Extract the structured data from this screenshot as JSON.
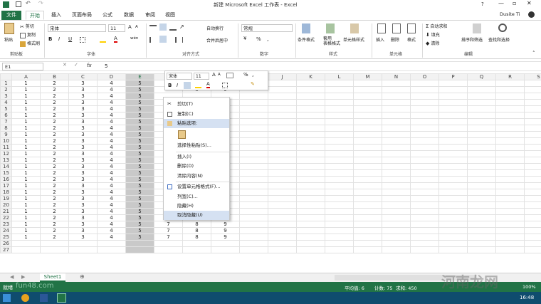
{
  "window": {
    "title": "新建 Microsoft Excel 工作表 - Excel",
    "user": "Dusite Ti",
    "help": "?"
  },
  "tabs": [
    "文件",
    "开始",
    "插入",
    "页面布局",
    "公式",
    "数据",
    "审阅",
    "视图"
  ],
  "ribbon": {
    "clipboard": {
      "paste": "粘贴",
      "cut": "剪切",
      "copy": "复制",
      "format_painter": "格式刷",
      "group": "剪贴板"
    },
    "font": {
      "name": "宋体",
      "size": "11",
      "bold": "B",
      "italic": "I",
      "underline": "U",
      "grow": "A",
      "shrink": "A",
      "wen": "wén",
      "group": "字体"
    },
    "alignment": {
      "wrap": "自动换行",
      "merge": "合并后居中",
      "group": "对齐方式"
    },
    "number": {
      "format": "常规",
      "percent": "%",
      "comma": ",",
      "group": "数字"
    },
    "styles": {
      "conditional": "条件格式",
      "table_format": "套用\n表格格式",
      "cell_styles": "单元格样式",
      "group": "样式"
    },
    "cells": {
      "insert": "插入",
      "delete": "删除",
      "format": "格式",
      "group": "单元格"
    },
    "editing": {
      "autosum": "自动求和",
      "fill": "填充",
      "clear": "清除",
      "sort": "排序和筛选",
      "find": "查找和选择",
      "group": "编辑"
    }
  },
  "formula_bar": {
    "name_box": "E1",
    "fx": "fx",
    "value": "5"
  },
  "columns": [
    "A",
    "B",
    "C",
    "D",
    "E",
    "F",
    "G",
    "H",
    "I",
    "J",
    "K",
    "L",
    "M",
    "N",
    "O",
    "P",
    "Q",
    "R",
    "S"
  ],
  "rows": [
    [
      "1",
      "2",
      "3",
      "4",
      "5",
      "",
      "8",
      "9"
    ],
    [
      "1",
      "2",
      "3",
      "4",
      "5",
      "",
      "8",
      "9"
    ],
    [
      "1",
      "2",
      "3",
      "4",
      "5",
      "",
      "",
      ""
    ],
    [
      "1",
      "2",
      "3",
      "4",
      "5",
      "",
      "",
      ""
    ],
    [
      "1",
      "2",
      "3",
      "4",
      "5",
      "",
      "",
      ""
    ],
    [
      "1",
      "2",
      "3",
      "4",
      "5",
      "",
      "",
      ""
    ],
    [
      "1",
      "2",
      "3",
      "4",
      "5",
      "",
      "",
      ""
    ],
    [
      "1",
      "2",
      "3",
      "4",
      "5",
      "",
      "",
      ""
    ],
    [
      "1",
      "2",
      "3",
      "4",
      "5",
      "",
      "",
      ""
    ],
    [
      "1",
      "2",
      "3",
      "4",
      "5",
      "",
      "",
      ""
    ],
    [
      "1",
      "2",
      "3",
      "4",
      "5",
      "",
      "",
      ""
    ],
    [
      "1",
      "2",
      "3",
      "4",
      "5",
      "",
      "",
      ""
    ],
    [
      "1",
      "2",
      "3",
      "4",
      "5",
      "",
      "",
      ""
    ],
    [
      "1",
      "2",
      "3",
      "4",
      "5",
      "",
      "",
      ""
    ],
    [
      "1",
      "2",
      "3",
      "4",
      "5",
      "",
      "",
      ""
    ],
    [
      "1",
      "2",
      "3",
      "4",
      "5",
      "",
      "",
      ""
    ],
    [
      "1",
      "2",
      "3",
      "4",
      "5",
      "",
      "",
      ""
    ],
    [
      "1",
      "2",
      "3",
      "4",
      "5",
      "",
      "",
      ""
    ],
    [
      "1",
      "2",
      "3",
      "4",
      "5",
      "",
      "",
      ""
    ],
    [
      "1",
      "2",
      "3",
      "4",
      "5",
      "7",
      "8",
      "9"
    ],
    [
      "1",
      "2",
      "3",
      "4",
      "5",
      "7",
      "8",
      "9"
    ],
    [
      "1",
      "2",
      "3",
      "4",
      "5",
      "7",
      "8",
      "9"
    ],
    [
      "1",
      "2",
      "3",
      "4",
      "5",
      "7",
      "8",
      "9"
    ],
    [
      "1",
      "2",
      "3",
      "4",
      "5",
      "7",
      "8",
      "9"
    ],
    [
      "1",
      "2",
      "3",
      "4",
      "5",
      "7",
      "8",
      "9"
    ],
    [
      "",
      "",
      "",
      "",
      "",
      "",
      "",
      ""
    ],
    [
      "",
      "",
      "",
      "",
      "",
      "",
      "",
      ""
    ]
  ],
  "minibar": {
    "font": "宋体",
    "size": "11",
    "bold": "B",
    "italic": "I",
    "percent": "%",
    "comma": ","
  },
  "context_menu": [
    "剪切(T)",
    "复制(C)",
    "粘贴选项:",
    "选择性粘贴(S)...",
    "插入(I)",
    "删除(D)",
    "清除内容(N)",
    "设置单元格格式(F)...",
    "列宽(C)...",
    "隐藏(H)",
    "取消隐藏(U)"
  ],
  "sheet_tab": "Sheet1",
  "status": {
    "ready": "就绪",
    "average": "平均值: 6",
    "count": "计数: 75",
    "sum": "求和: 450",
    "zoom": "100%"
  },
  "watermark": {
    "left": "fun48.com",
    "right": "河南龙网"
  },
  "clock": "16:48",
  "colors": {
    "excel_green": "#217346",
    "selection_gray": "#c9c9c9",
    "menu_highlight": "#d5e1f2"
  }
}
